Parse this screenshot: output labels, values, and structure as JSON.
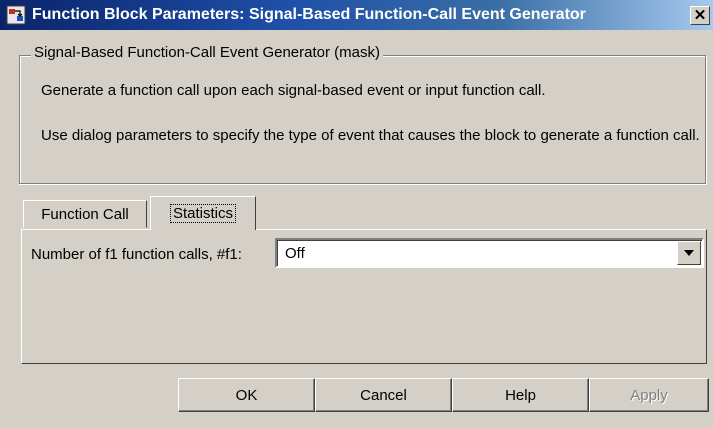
{
  "window": {
    "title": "Function Block Parameters: Signal-Based Function-Call Event Generator",
    "close_symbol": "✕"
  },
  "mask": {
    "group_title": "Signal-Based Function-Call Event Generator (mask)",
    "description_1": "Generate a function call upon each signal-based event or input function call.",
    "description_2": "Use dialog parameters to specify the type of event that causes the block to generate a function call."
  },
  "tabs": [
    {
      "label": "Function Call",
      "selected": false
    },
    {
      "label": "Statistics",
      "selected": true
    }
  ],
  "statistics": {
    "param_label": "Number of f1 function calls, #f1:",
    "param_value": "Off"
  },
  "buttons": {
    "ok": "OK",
    "cancel": "Cancel",
    "help": "Help",
    "apply": "Apply"
  },
  "icons": {
    "app": "simulink-block-icon",
    "close": "close-icon",
    "dropdown": "chevron-down-icon"
  },
  "colors": {
    "titlebar_start": "#0a246a",
    "titlebar_end": "#a6caf0",
    "face": "#d4d0c8"
  }
}
